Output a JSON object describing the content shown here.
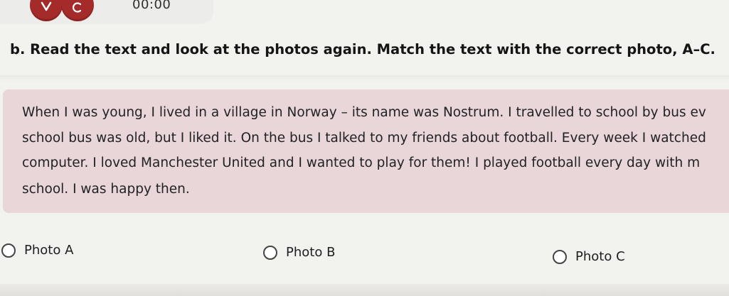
{
  "audio": {
    "timer": "00:00",
    "buttons": [
      "play-icon",
      "refresh-icon"
    ],
    "accent_color": "#a52a2a"
  },
  "exercise": {
    "instruction": "b. Read the text and look at the photos again. Match the text with the correct photo, A–C.",
    "reading_lines": [
      "When I was young, I lived in a village in Norway – its name was Nostrum. I travelled to school by bus ev",
      "school bus was old, but I liked it. On the bus I talked to my friends about football. Every week I watched",
      "computer. I loved Manchester United and I wanted to play for them! I played football every day with m",
      "school. I was happy then."
    ],
    "reading_box_color": "#e8d6d8",
    "options": [
      "Photo A",
      "Photo B",
      "Photo C"
    ]
  }
}
